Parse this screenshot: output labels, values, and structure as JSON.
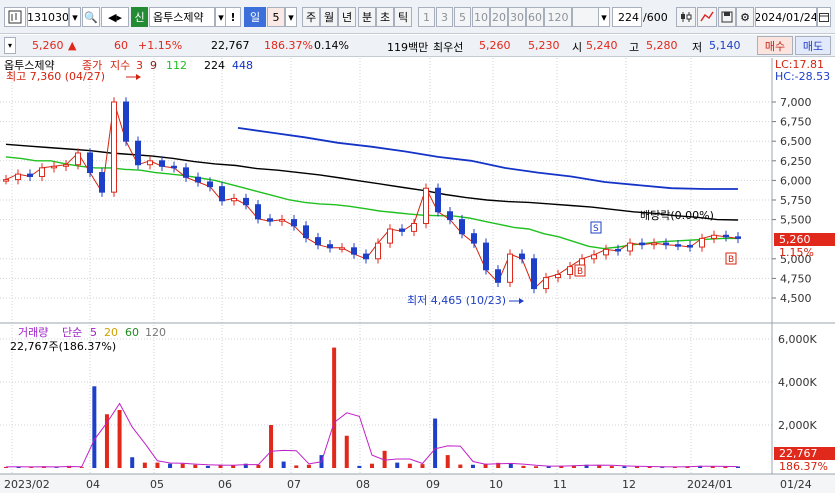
{
  "toolbar": {
    "code": "131030",
    "market_badge": "신",
    "stock_name": "옵투스제약",
    "warn": "!",
    "period_selected": "일",
    "period_num": "5",
    "periods": [
      "주",
      "월",
      "년",
      "분",
      "초",
      "틱"
    ],
    "minutes": [
      "1",
      "3",
      "5",
      "10",
      "20",
      "30",
      "60",
      "120"
    ],
    "count": "224",
    "count_total": "/600",
    "date": "2024/01/24"
  },
  "info": {
    "price": "5,260",
    "change": "60",
    "change_pct": "+1.15%",
    "volume": "22,767",
    "vol_ratio": "186.37%",
    "turnover": "0.14%",
    "amount": "119백만",
    "best": "최우선",
    "ask": "5,260",
    "bid": "5,230",
    "open_lbl": "시",
    "open": "5,240",
    "high_lbl": "고",
    "high": "5,280",
    "low_lbl": "저",
    "low": "5,140",
    "buy": "매수",
    "sell": "매도"
  },
  "colors": {
    "ma3": "#d4230f",
    "ma9": "#8b1b1b",
    "ma112": "#20c020",
    "ma224": "#000000",
    "ma448": "#1434c8",
    "up": "#e0281b",
    "down": "#1e3fc7",
    "accent": "#e0281b"
  },
  "chart_data": [
    {
      "type": "candlestick",
      "title": "옵투스제약",
      "legend": [
        "종가",
        "지수",
        "3",
        "9",
        "112",
        "224",
        "448"
      ],
      "annotations": {
        "high": "최고 7,360 (04/27)",
        "low": "최저 4,465 (10/23)",
        "dividend": "배당락(0.00%)",
        "lc": "LC:17.81",
        "hc": "HC:-28.53",
        "current": "5,260",
        "current_pct": "1.15%",
        "markers": [
          "S",
          "B",
          "B"
        ]
      },
      "y_ticks": [
        "7,000",
        "6,750",
        "6,500",
        "6,250",
        "6,000",
        "5,750",
        "5,500",
        "5,260",
        "5,000",
        "4,750",
        "4,500"
      ],
      "ylim": [
        4350,
        7450
      ],
      "x_ticks": [
        "2023/02",
        "04",
        "05",
        "06",
        "07",
        "08",
        "09",
        "10",
        "11",
        "12",
        "2024/01",
        "01/24"
      ],
      "close": [
        6010,
        6080,
        6050,
        6160,
        6180,
        6200,
        6350,
        6100,
        5850,
        7000,
        6500,
        6200,
        6250,
        6180,
        6160,
        6040,
        5980,
        5920,
        5740,
        5770,
        5690,
        5510,
        5480,
        5500,
        5420,
        5270,
        5180,
        5140,
        5140,
        5060,
        5000,
        5200,
        5380,
        5350,
        5450,
        5900,
        5600,
        5500,
        5320,
        5200,
        4860,
        4700,
        5060,
        5000,
        4620,
        4760,
        4800,
        4900,
        5000,
        5050,
        5120,
        5100,
        5200,
        5180,
        5200,
        5180,
        5170,
        5150,
        5260,
        5300,
        5280,
        5260
      ],
      "ma112": [
        6300,
        6280,
        6250,
        6250,
        6210,
        6180,
        6160,
        6160,
        6140,
        6130,
        6100,
        6080,
        6060,
        6030,
        6000,
        5950,
        5900,
        5850,
        5800,
        5750,
        5720,
        5700,
        5690,
        5670,
        5640,
        5610,
        5590,
        5570,
        5555,
        5550,
        5545,
        5520,
        5480,
        5440,
        5400,
        5380,
        5320,
        5280,
        5220,
        5160,
        5130,
        5150,
        5180,
        5200,
        5220,
        5230,
        5240,
        5250,
        5260,
        5260
      ],
      "ma224": [
        6460,
        6440,
        6420,
        6400,
        6380,
        6350,
        6330,
        6310,
        6280,
        6240,
        6210,
        6190,
        6150,
        6130,
        6100,
        6070,
        6030,
        5990,
        5950,
        5910,
        5870,
        5820,
        5780,
        5750,
        5730,
        5720,
        5700,
        5680,
        5660,
        5630,
        5600,
        5580,
        5550,
        5530,
        5500,
        5495
      ],
      "ma448": [
        6670,
        6610,
        6550,
        6480,
        6430,
        6370,
        6300,
        6250,
        6160,
        6100,
        6050,
        5980,
        5940,
        5900,
        5890,
        5890
      ]
    },
    {
      "type": "bar",
      "title": "거래량",
      "legend": [
        "거래량",
        "단순",
        "5",
        "20",
        "60",
        "120"
      ],
      "current_label": "22,767주(186.37%)",
      "y_ticks": [
        "6,000K",
        "4,000K",
        "2,000K"
      ],
      "ylim": [
        0,
        6500
      ],
      "unit": "K",
      "highlight": {
        "value": "22,767",
        "pct": "186.37%"
      },
      "values": [
        50,
        60,
        40,
        80,
        30,
        100,
        40,
        3800,
        2500,
        2700,
        500,
        250,
        250,
        200,
        200,
        150,
        100,
        150,
        120,
        200,
        150,
        2000,
        300,
        120,
        150,
        600,
        5600,
        1500,
        100,
        200,
        800,
        250,
        200,
        180,
        2300,
        600,
        160,
        150,
        200,
        240,
        200,
        100,
        80,
        90,
        100,
        120,
        150,
        130,
        90,
        80,
        70,
        60,
        40,
        60,
        80,
        100,
        70,
        60,
        70
      ]
    }
  ]
}
